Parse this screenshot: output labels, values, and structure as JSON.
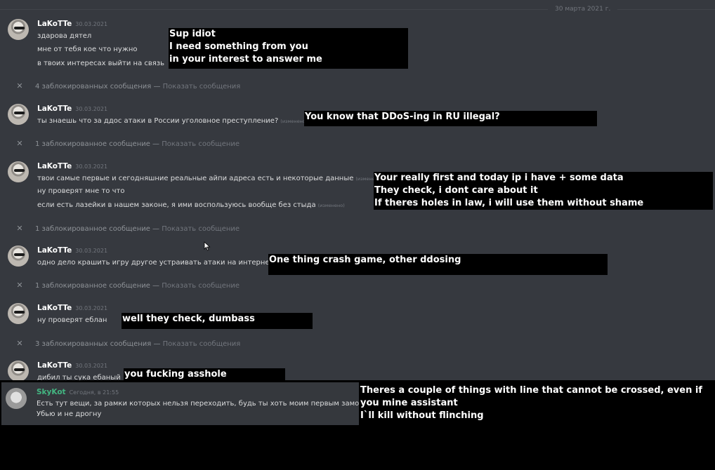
{
  "chat": {
    "date_divider": "30 марта 2021 г.",
    "groups": [
      {
        "author": "LaKoTTe",
        "time": "30.03.2021",
        "lines": [
          {
            "text": "здарова дятел",
            "edited": ""
          },
          {
            "text": "мне от тебя кое что нужно",
            "edited": ""
          },
          {
            "text": "в твоих интересах выйти на связь",
            "edited": ""
          }
        ]
      },
      {
        "author": "LaKoTTe",
        "time": "30.03.2021",
        "lines": [
          {
            "text": "ты знаешь что за ддос атаки в России уголовное преступление?",
            "edited": "(изменено)"
          }
        ]
      },
      {
        "author": "LaKoTTe",
        "time": "30.03.2021",
        "lines": [
          {
            "text": "твои самые первые и сегодняшние реальные айпи адреса есть и некоторые данные",
            "edited": "(изменено)"
          },
          {
            "text": "ну проверят мне то что",
            "edited": ""
          },
          {
            "text": "если есть лазейки в нашем законе, я ими воспользуюсь вообще без стыда",
            "edited": "(изменено)"
          }
        ]
      },
      {
        "author": "LaKoTTe",
        "time": "30.03.2021",
        "lines": [
          {
            "text": "одно дело крашить игру другое устраивать атаки на интернет",
            "edited": ""
          }
        ]
      },
      {
        "author": "LaKoTTe",
        "time": "30.03.2021",
        "lines": [
          {
            "text": "ну проверят еблан",
            "edited": ""
          }
        ]
      },
      {
        "author": "LaKoTTe",
        "time": "30.03.2021",
        "lines": [
          {
            "text": "дибил ты сука ебаный",
            "edited": ""
          }
        ]
      }
    ],
    "blocked": [
      {
        "text": "4 заблокированных сообщения — ",
        "action": "Показать сообщения"
      },
      {
        "text": "1 заблокированное сообщение — ",
        "action": "Показать сообщение"
      },
      {
        "text": "1 заблокированное сообщение — ",
        "action": "Показать сообщение"
      },
      {
        "text": "1 заблокированное сообщение — ",
        "action": "Показать сообщение"
      },
      {
        "text": "3 заблокированных сообщения — ",
        "action": "Показать сообщения"
      }
    ],
    "reply": {
      "author": "SkyKot",
      "time": "Сегодня, в 21:55",
      "lines": [
        "Есть тут вещи, за рамки которых нельзя переходить, будь ты хоть моим первым замом",
        "Убью и не дрогну"
      ]
    }
  },
  "overlays": [
    [
      "Sup idiot",
      "I need something from you",
      "in your interest to answer me"
    ],
    [
      "You know that DDoS-ing in RU illegal?"
    ],
    [
      "Your really first and today ip i have + some data",
      "They check, i dont care about it",
      "If theres holes in law, i will use them without shame"
    ],
    [
      "One thing crash game, other ddosing"
    ],
    [
      "well they check, dumbass"
    ],
    [
      "you fucking asshole"
    ],
    [
      "Theres a couple of things with line that cannot be crossed, even if",
      "you mine assistant",
      "I`ll kill without flinching"
    ]
  ],
  "colors": {
    "chat_bg": "#36393f",
    "author": "#ffffff",
    "reply_author": "#43b581",
    "muted": "#72767d",
    "overlay_bg": "#000000"
  },
  "icons": [
    "close-icon",
    "cursor-icon",
    "avatar"
  ]
}
